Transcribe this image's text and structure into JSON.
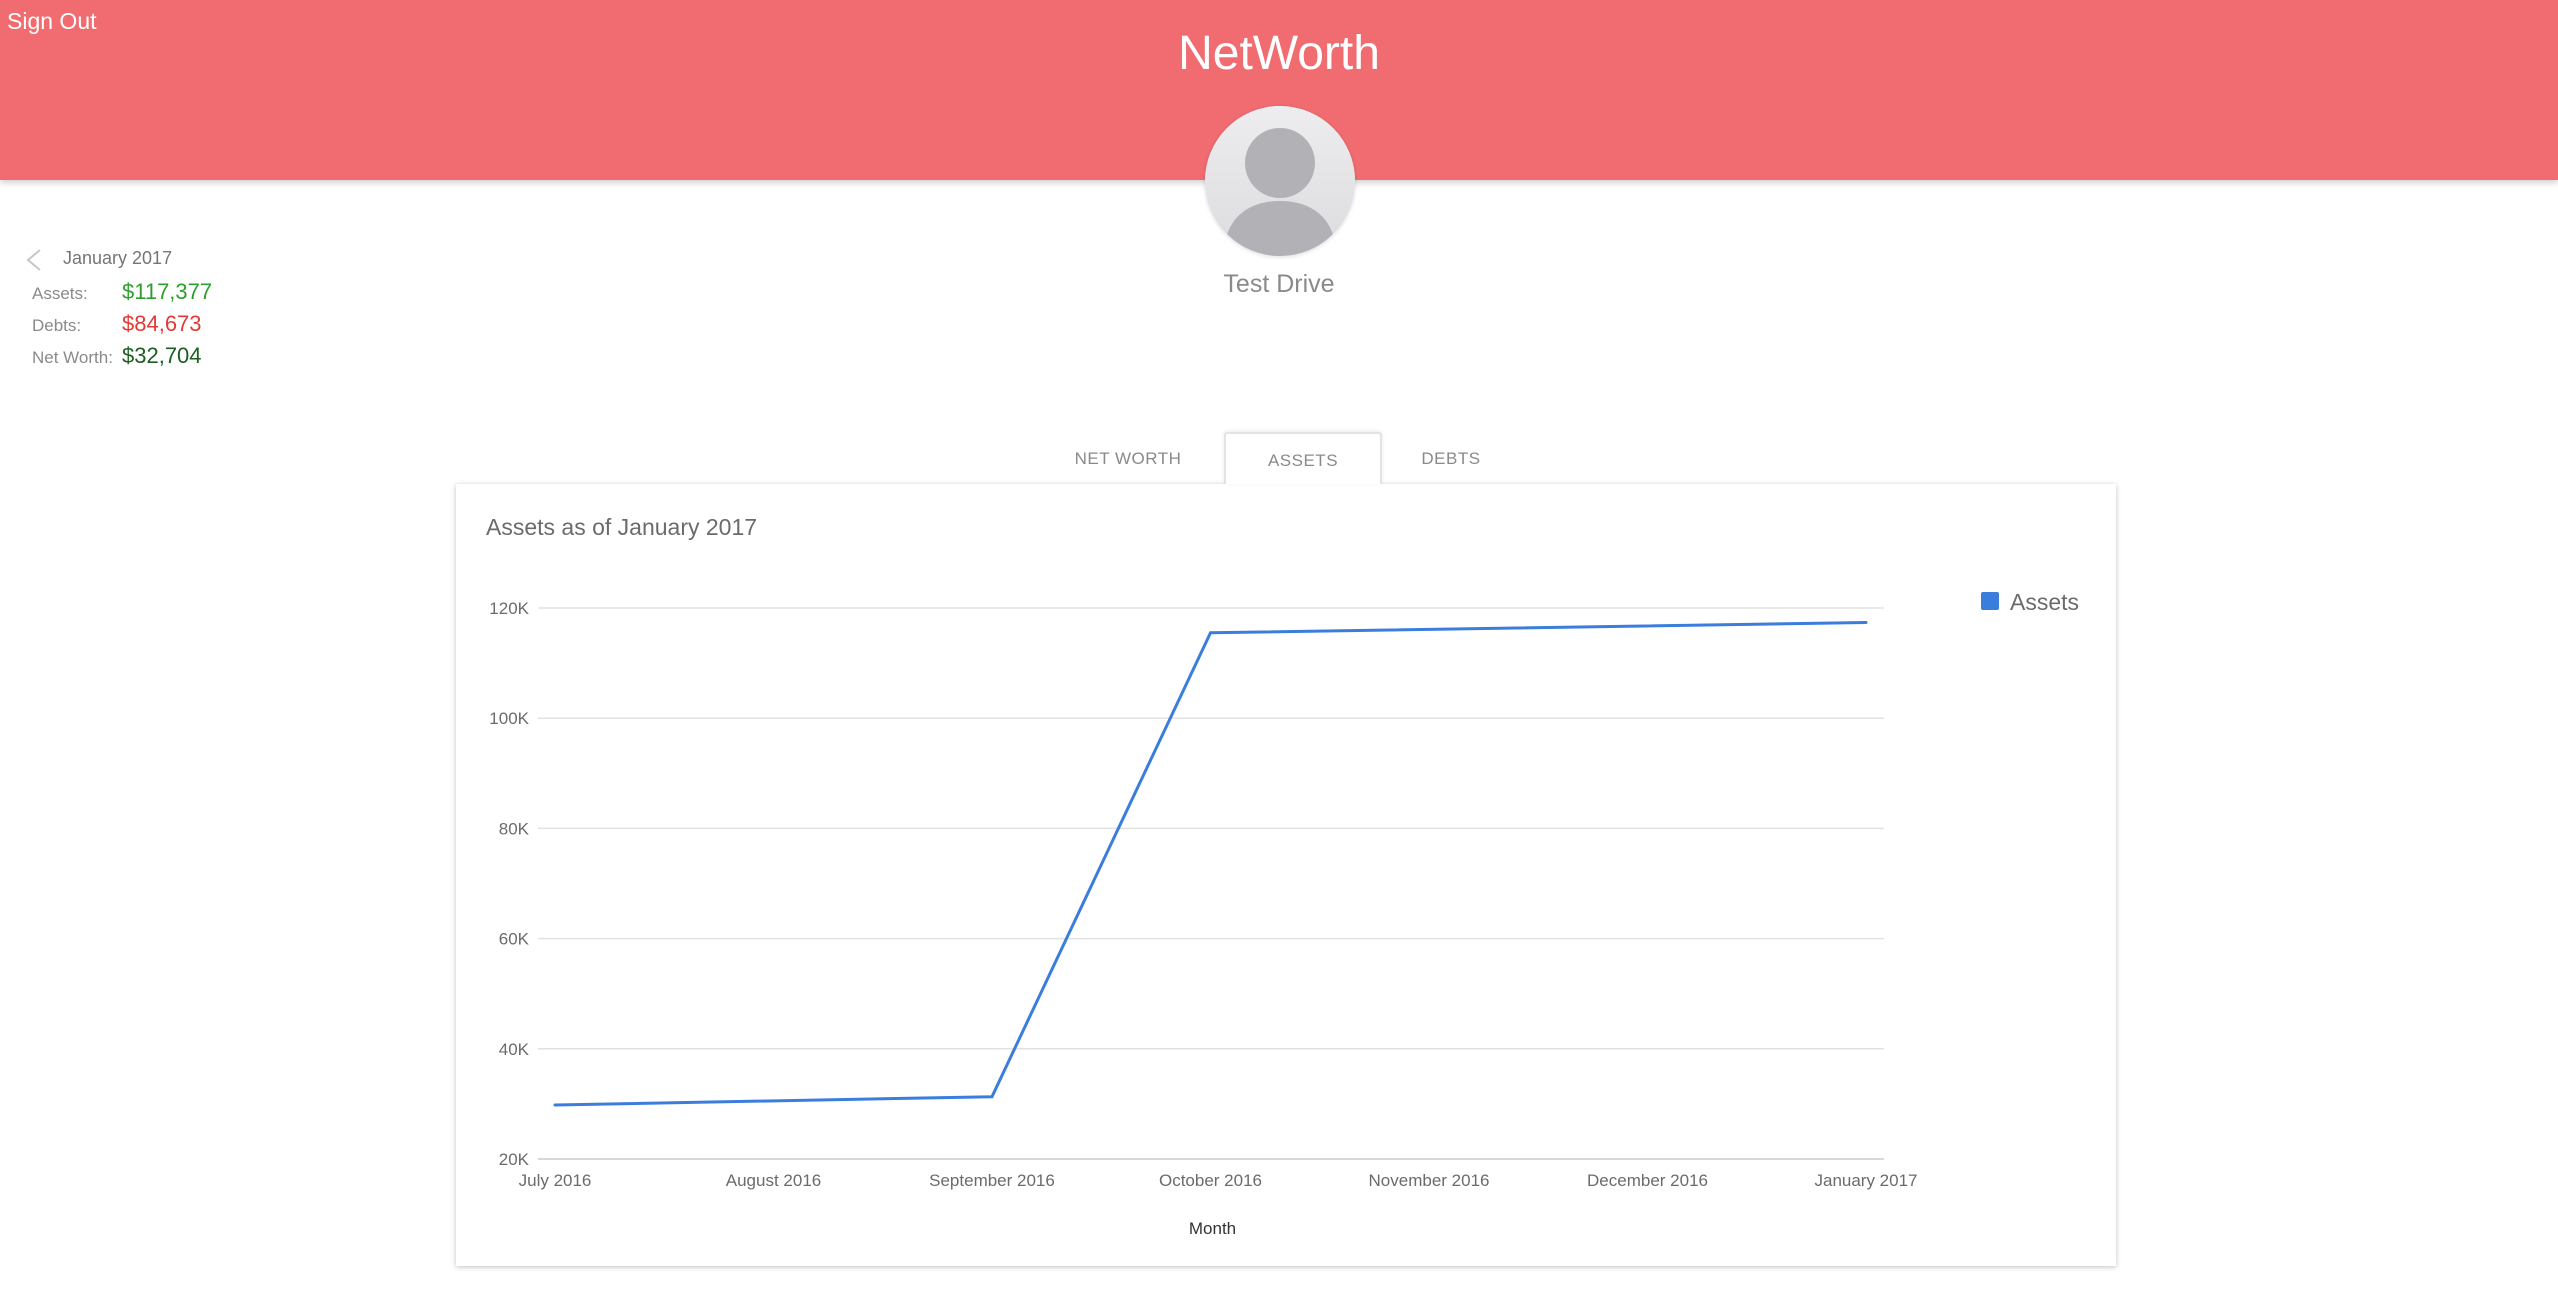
{
  "header": {
    "sign_out_label": "Sign Out",
    "app_title": "NetWorth",
    "background_color": "#f06c71"
  },
  "user": {
    "name": "Test Drive",
    "avatar_icon": "default-user-avatar-icon"
  },
  "summary": {
    "month": "January 2017",
    "back_icon": "chevron-left-icon",
    "assets_label": "Assets:",
    "assets_value": "$117,377",
    "assets_color": "#2e9e2e",
    "debts_label": "Debts:",
    "debts_value": "$84,673",
    "debts_color": "#e53935",
    "networth_label": "Net Worth:",
    "networth_value": "$32,704",
    "networth_color": "#1b5e20"
  },
  "tabs": [
    {
      "label": "NET WORTH",
      "active": false
    },
    {
      "label": "ASSETS",
      "active": true
    },
    {
      "label": "DEBTS",
      "active": false
    }
  ],
  "chart": {
    "title": "Assets as of January 2017"
  },
  "chart_data": {
    "type": "line",
    "title": "Assets as of January 2017",
    "xlabel": "Month",
    "ylabel": "",
    "categories": [
      "July 2016",
      "August 2016",
      "September 2016",
      "October 2016",
      "November 2016",
      "December 2016",
      "January 2017"
    ],
    "series": [
      {
        "name": "Assets",
        "color": "#3b7ddd",
        "values": [
          29800,
          null,
          31300,
          115500,
          null,
          null,
          117377
        ]
      }
    ],
    "y_ticks": [
      20000,
      40000,
      60000,
      80000,
      100000,
      120000
    ],
    "y_tick_labels": [
      "20K",
      "40K",
      "60K",
      "80K",
      "100K",
      "120K"
    ],
    "ylim": [
      20000,
      120000
    ],
    "grid": true,
    "legend_position": "right"
  }
}
